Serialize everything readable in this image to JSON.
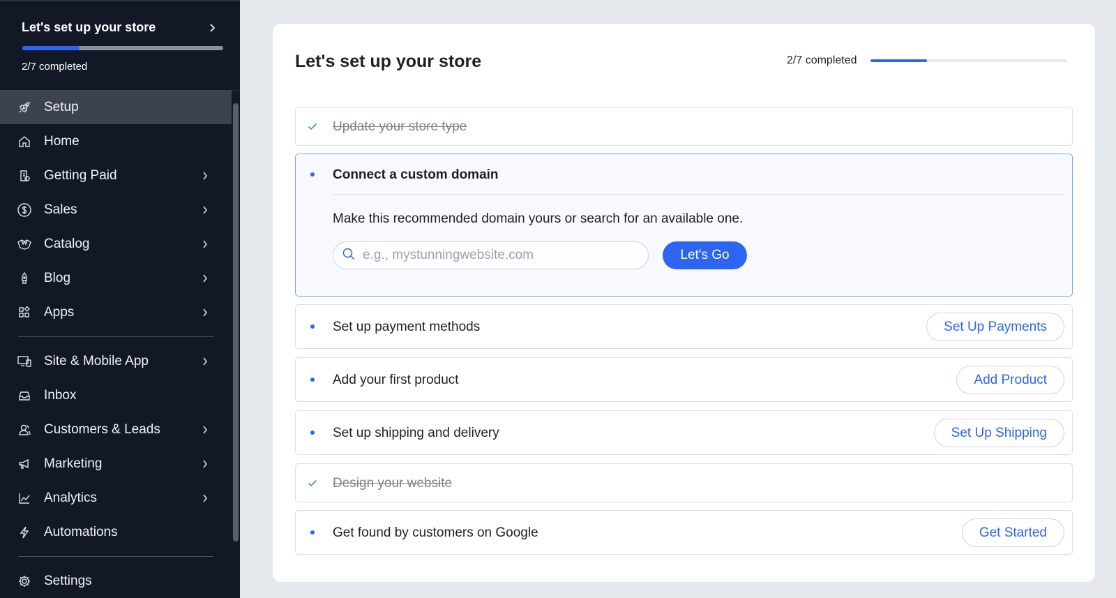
{
  "sidebar": {
    "title": "Let's set up your store",
    "progress": {
      "completed": 2,
      "total": 7,
      "label": "2/7 completed"
    },
    "items": [
      {
        "label": "Setup",
        "icon": "rocket-icon",
        "active": true,
        "has_chevron": false
      },
      {
        "label": "Home",
        "icon": "home-icon",
        "active": false,
        "has_chevron": false
      },
      {
        "label": "Getting Paid",
        "icon": "receipt-icon",
        "active": false,
        "has_chevron": true
      },
      {
        "label": "Sales",
        "icon": "dollar-icon",
        "active": false,
        "has_chevron": true
      },
      {
        "label": "Catalog",
        "icon": "catalog-icon",
        "active": false,
        "has_chevron": true
      },
      {
        "label": "Blog",
        "icon": "pen-icon",
        "active": false,
        "has_chevron": true
      },
      {
        "label": "Apps",
        "icon": "apps-icon",
        "active": false,
        "has_chevron": true
      },
      {
        "label": "Site & Mobile App",
        "icon": "devices-icon",
        "active": false,
        "has_chevron": true
      },
      {
        "label": "Inbox",
        "icon": "inbox-icon",
        "active": false,
        "has_chevron": false
      },
      {
        "label": "Customers & Leads",
        "icon": "customers-icon",
        "active": false,
        "has_chevron": true
      },
      {
        "label": "Marketing",
        "icon": "megaphone-icon",
        "active": false,
        "has_chevron": true
      },
      {
        "label": "Analytics",
        "icon": "analytics-icon",
        "active": false,
        "has_chevron": true
      },
      {
        "label": "Automations",
        "icon": "lightning-icon",
        "active": false,
        "has_chevron": false
      },
      {
        "label": "Settings",
        "icon": "gear-icon",
        "active": false,
        "has_chevron": false
      }
    ]
  },
  "main": {
    "title": "Let's set up your store",
    "progress": {
      "completed": 2,
      "total": 7,
      "label": "2/7 completed"
    },
    "tasks": [
      {
        "label": "Update your store type",
        "done": true
      },
      {
        "label": "Connect a custom domain",
        "done": false,
        "expanded": true,
        "description": "Make this recommended domain yours or search for an available one.",
        "search_placeholder": "e.g., mystunningwebsite.com",
        "search_value": "",
        "button": "Let's Go"
      },
      {
        "label": "Set up payment methods",
        "done": false,
        "button": "Set Up Payments"
      },
      {
        "label": "Add your first product",
        "done": false,
        "button": "Add Product"
      },
      {
        "label": "Set up shipping and delivery",
        "done": false,
        "button": "Set Up Shipping"
      },
      {
        "label": "Design your website",
        "done": true
      },
      {
        "label": "Get found by customers on Google",
        "done": false,
        "button": "Get Started"
      }
    ]
  },
  "colors": {
    "accent": "#2d64f0",
    "sidebar_bg": "#121826",
    "sidebar_active": "#3d4250",
    "page_bg": "#e4e7ec",
    "check": "#3aa463"
  }
}
